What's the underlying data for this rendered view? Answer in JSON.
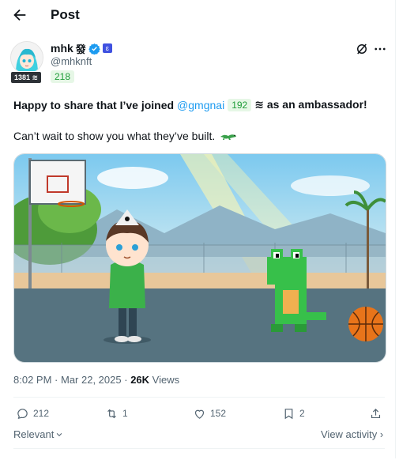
{
  "header": {
    "title": "Post"
  },
  "author": {
    "display_name": "mhk",
    "name_glyph": "發",
    "handle": "@mhknft",
    "badge_count": "1381 ≋",
    "green_count": "218",
    "verified_color": "#1d9bf0",
    "affiliate_color": "#3f51e0"
  },
  "tweet": {
    "line1_pre": "Happy to share that I’ve joined",
    "mention": "@gmgnai",
    "mention_count": "192",
    "line1_post": "≋ as an ambassador!",
    "line2": "Can’t wait to show you what they’ve built.",
    "line2_emoji": "lizard"
  },
  "media": {
    "alt_icon": "image"
  },
  "meta": {
    "time": "8:02 PM",
    "date": "Mar 22, 2025",
    "views_count": "26K",
    "views_label": "Views"
  },
  "actions": {
    "replies": "212",
    "reposts": "1",
    "likes": "152",
    "bookmarks": "2"
  },
  "footer": {
    "sort_label": "Relevant",
    "view_activity": "View activity ›"
  },
  "colors": {
    "accent": "#1d9bf0",
    "text_secondary": "#536471",
    "green_badge_bg": "#e6f7e6",
    "green_badge_text": "#1f9d39"
  }
}
